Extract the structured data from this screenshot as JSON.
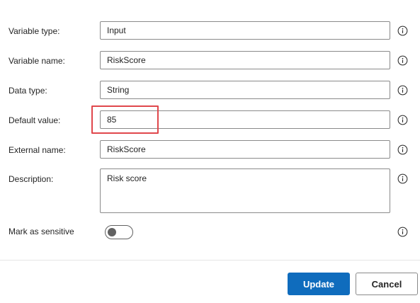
{
  "form": {
    "variable_type": {
      "label": "Variable type:",
      "value": "Input"
    },
    "variable_name": {
      "label": "Variable name:",
      "value": "RiskScore"
    },
    "data_type": {
      "label": "Data type:",
      "value": "String"
    },
    "default_value": {
      "label": "Default value:",
      "value": "85"
    },
    "external_name": {
      "label": "External name:",
      "value": "RiskScore"
    },
    "description": {
      "label": "Description:",
      "value": "Risk score"
    },
    "sensitive": {
      "label": "Mark as sensitive",
      "on": false
    }
  },
  "footer": {
    "update_label": "Update",
    "cancel_label": "Cancel"
  },
  "colors": {
    "primary": "#0f6cbd",
    "highlight": "#e0474c"
  },
  "icons": {
    "info": "info-circle-icon"
  }
}
